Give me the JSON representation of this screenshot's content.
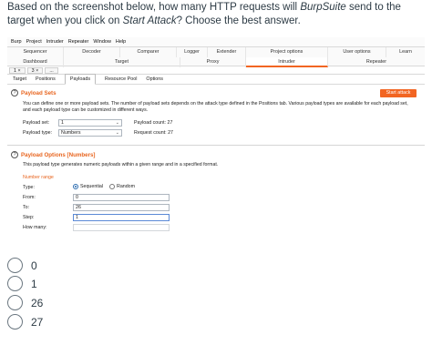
{
  "question": {
    "text_before": "Based on the screenshot below, how many HTTP requests will ",
    "tool": "BurpSuite",
    "text_mid": " send to the target when you click on ",
    "action": "Start Attack",
    "text_after": "? Choose the best answer."
  },
  "burp": {
    "menu": [
      "Burp",
      "Project",
      "Intruder",
      "Repeater",
      "Window",
      "Help"
    ],
    "tabs_row1": [
      "Sequencer",
      "Decoder",
      "Comparer",
      "Logger",
      "Extender",
      "Project options",
      "User options",
      "Learn"
    ],
    "tabs_row2": [
      "Dashboard",
      "Target",
      "Proxy",
      "Intruder",
      "Repeater"
    ],
    "active_tab": "Intruder",
    "attack_tabs": [
      "1 ×",
      "3 ×",
      "..."
    ],
    "inner_tabs": [
      "Target",
      "Positions",
      "Payloads",
      "Resource Pool",
      "Options"
    ],
    "active_inner_tab": "Payloads",
    "payload_sets": {
      "title": "Payload Sets",
      "start_button": "Start attack",
      "description": "You can define one or more payload sets. The number of payload sets depends on the attack type defined in the Positions tab. Various payload types are available for each payload set, and each payload type can be customized in different ways.",
      "payload_set_label": "Payload set:",
      "payload_set_value": "1",
      "payload_type_label": "Payload type:",
      "payload_type_value": "Numbers",
      "payload_count_label": "Payload count: 27",
      "request_count_label": "Request count: 27"
    },
    "payload_options": {
      "title": "Payload Options [Numbers]",
      "description": "This payload type generates numeric payloads within a given range and in a specified format.",
      "number_range_label": "Number range",
      "type_label": "Type:",
      "sequential_label": "Sequential",
      "random_label": "Random",
      "selected_type": "Sequential",
      "from_label": "From:",
      "from_value": "0",
      "to_label": "To:",
      "to_value": "26",
      "step_label": "Step:",
      "step_value": "1",
      "how_many_label": "How many:",
      "how_many_value": ""
    }
  },
  "answers": [
    "0",
    "1",
    "26",
    "27"
  ],
  "colors": {
    "accent": "#f26522",
    "text": "#2d3b45"
  }
}
